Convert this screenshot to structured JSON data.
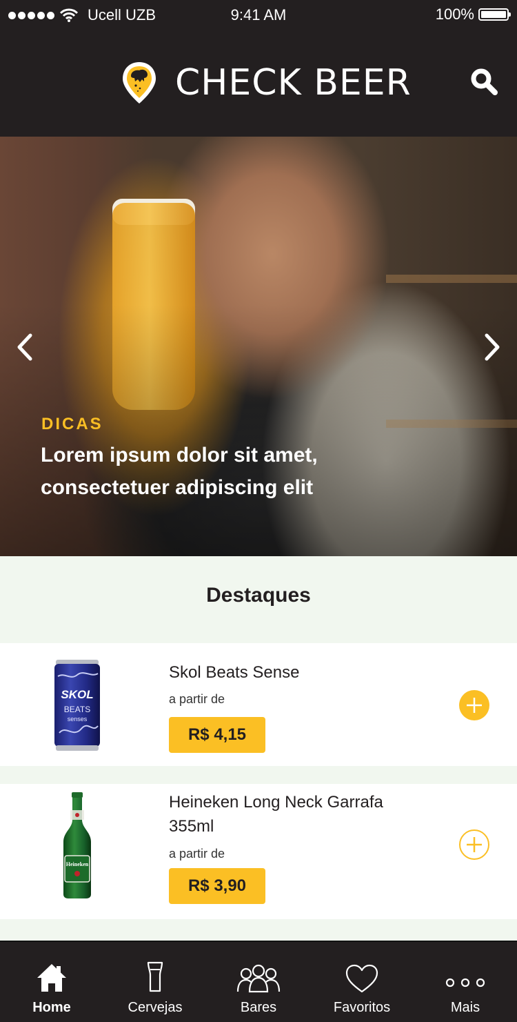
{
  "status_bar": {
    "carrier": "Ucell UZB",
    "time": "9:41 AM",
    "battery": "100%"
  },
  "header": {
    "title": "CHECK BEER"
  },
  "hero": {
    "tag": "DICAS",
    "title": "Lorem ipsum dolor sit amet, consectetuer adipiscing elit"
  },
  "section": {
    "title": "Destaques"
  },
  "products": [
    {
      "name": "Skol Beats Sense",
      "sub": "a partir de",
      "price": "R$ 4,15",
      "brand_text": "SKOL",
      "sub_brand": "BEATS",
      "variant": "senses"
    },
    {
      "name": "Heineken Long Neck Garrafa 355ml",
      "sub": "a partir de",
      "price": "R$ 3,90",
      "brand_text": "Heineken"
    }
  ],
  "tabs": [
    {
      "label": "Home",
      "icon": "home-icon",
      "active": true
    },
    {
      "label": "Cervejas",
      "icon": "beer-glass-icon"
    },
    {
      "label": "Bares",
      "icon": "people-icon"
    },
    {
      "label": "Favoritos",
      "icon": "heart-icon"
    },
    {
      "label": "Mais",
      "icon": "more-icon"
    }
  ],
  "colors": {
    "accent": "#fbbf24",
    "dark": "#231f20",
    "section_bg": "#f1f7ef"
  }
}
